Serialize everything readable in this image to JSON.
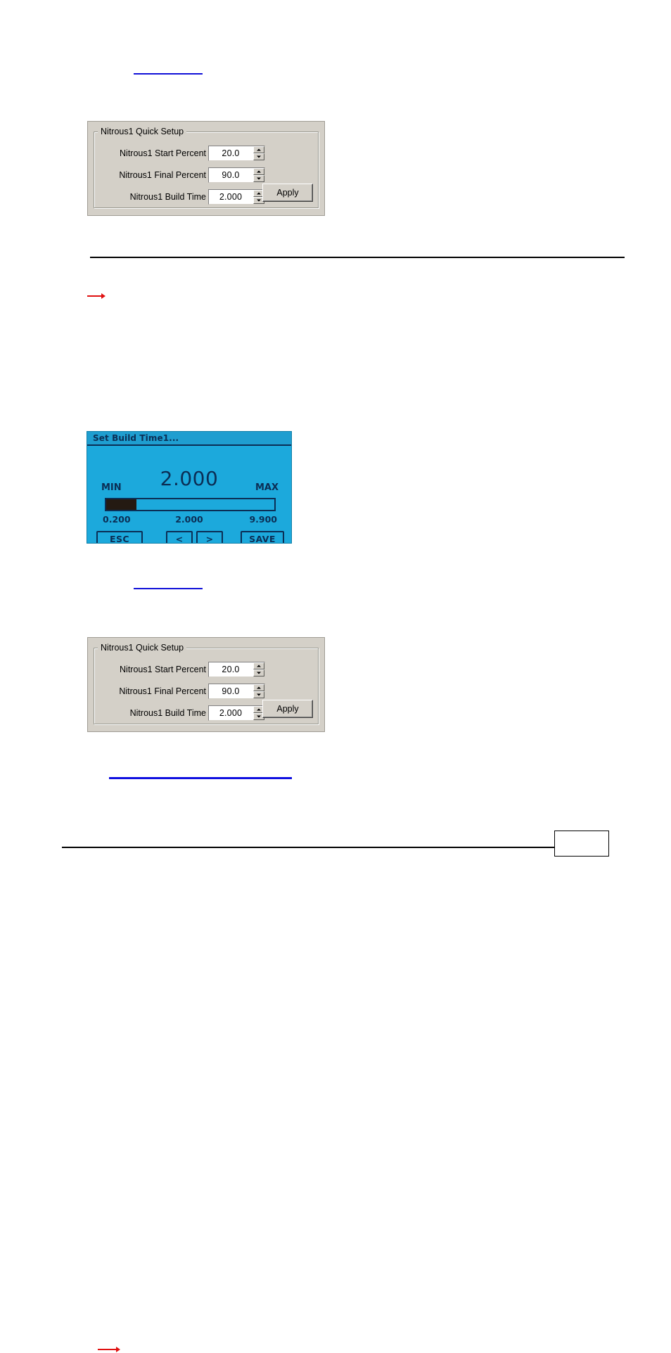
{
  "document": {
    "background_color": "#ffffff",
    "link_color": "#1010d8",
    "rule_color": "#000000"
  },
  "links": [
    {
      "name": "inline-cross-reference-top",
      "text": ""
    },
    {
      "name": "inline-cross-reference-middle",
      "text": ""
    },
    {
      "name": "inline-cross-reference-bottom",
      "text": ""
    }
  ],
  "panel_top": {
    "legend": "Nitrous1 Quick Setup",
    "panel_color": "#d4d0c8",
    "callout_color": "#e01010",
    "callout_target": "Nitrous1 Final Percent",
    "rows": [
      {
        "label": "Nitrous1 Start Percent",
        "value": "20.0",
        "spinner": true,
        "callout": false
      },
      {
        "label": "Nitrous1 Final Percent",
        "value": "90.0",
        "spinner": true,
        "callout": true
      },
      {
        "label": "Nitrous1 Build Time",
        "value": "2.000",
        "spinner": true,
        "callout": false
      }
    ],
    "apply_label": "Apply",
    "spinner_up_icon": "caret-up-icon",
    "spinner_down_icon": "caret-down-icon"
  },
  "lcd_dialog": {
    "title": "Set Build Time1...",
    "screen_color": "#1ca9dc",
    "ink_color": "#0b2e55",
    "min_label": "MIN",
    "max_label": "MAX",
    "current_value": "2.000",
    "scale_min": "0.200",
    "scale_mid": "2.000",
    "scale_max": "9.900",
    "slider": {
      "min": 0.2,
      "value": 2.0,
      "max": 9.9,
      "fill_percent": 18
    },
    "buttons": [
      {
        "name": "esc-button",
        "label": "ESC"
      },
      {
        "name": "prev-button",
        "label": "<"
      },
      {
        "name": "next-button",
        "label": ">"
      },
      {
        "name": "save-button",
        "label": "SAVE"
      }
    ]
  },
  "panel_bottom": {
    "legend": "Nitrous1 Quick Setup",
    "panel_color": "#d4d0c8",
    "callout_color": "#e01010",
    "callout_target": "Nitrous1 Build Time",
    "rows": [
      {
        "label": "Nitrous1 Start Percent",
        "value": "20.0",
        "spinner": true,
        "callout": false
      },
      {
        "label": "Nitrous1 Final Percent",
        "value": "90.0",
        "spinner": true,
        "callout": false
      },
      {
        "label": "Nitrous1 Build Time",
        "value": "2.000",
        "spinner": true,
        "callout": true
      }
    ],
    "apply_label": "Apply",
    "spinner_up_icon": "caret-up-icon",
    "spinner_down_icon": "caret-down-icon"
  },
  "footer": {
    "page_number": ""
  }
}
